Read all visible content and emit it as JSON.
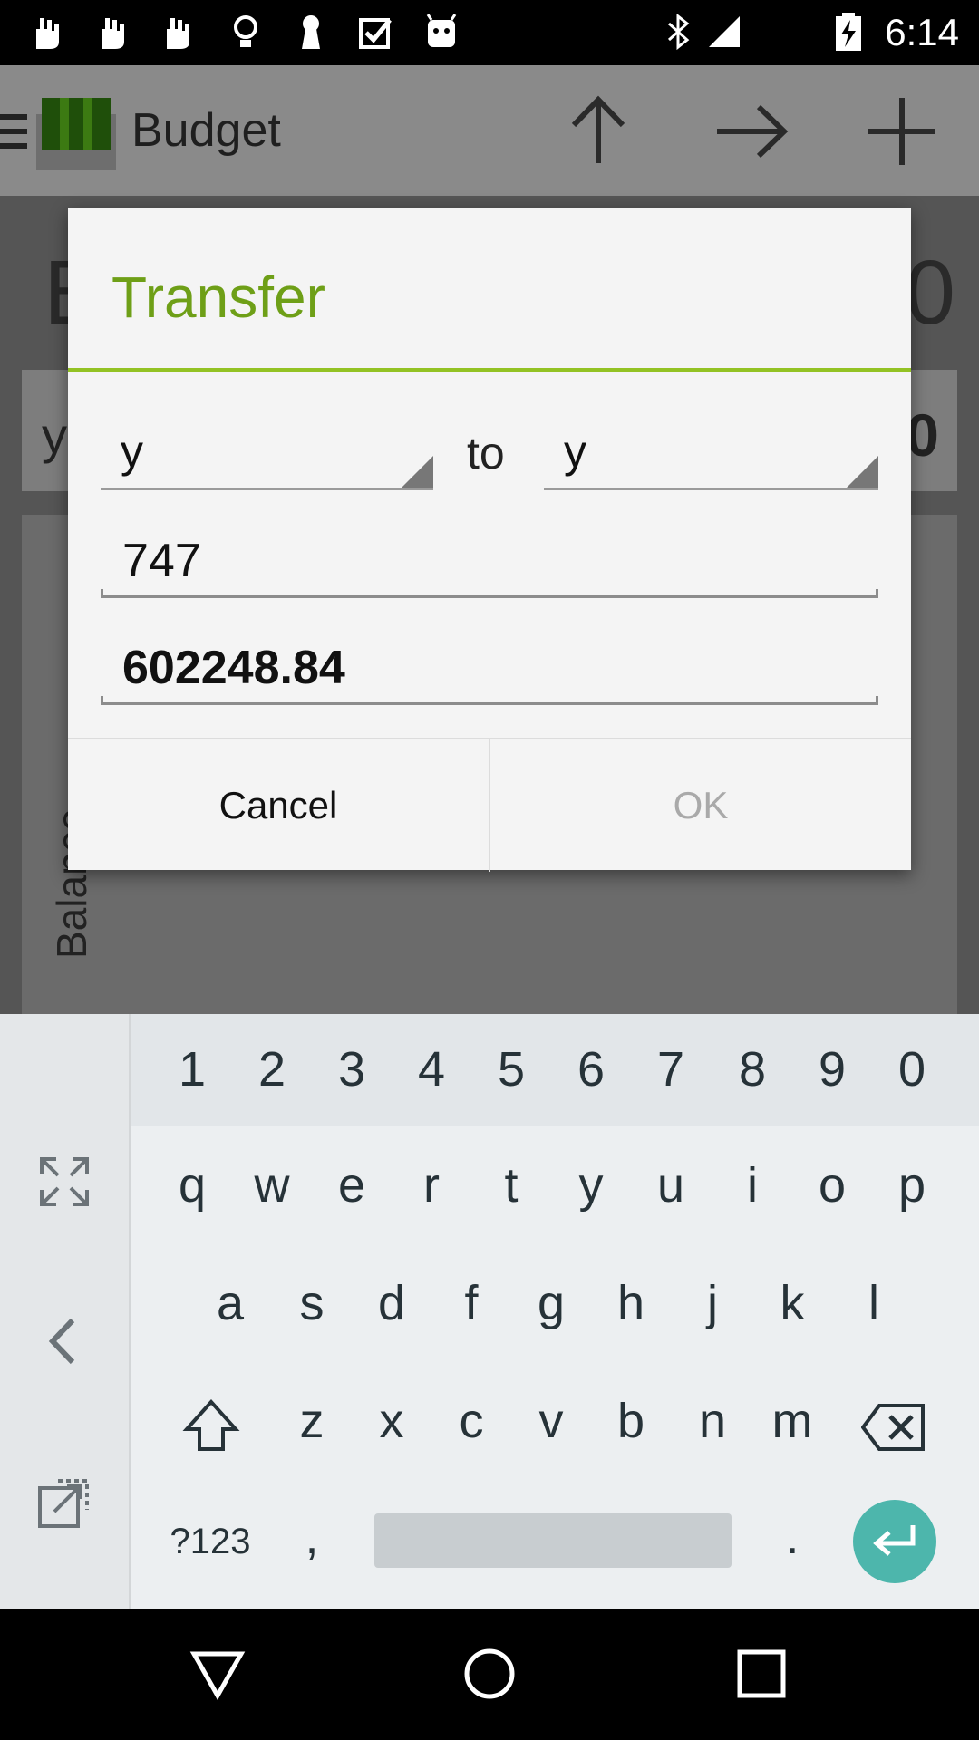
{
  "status_bar": {
    "time": "6:14",
    "left_icons": [
      "hand-icon",
      "hand-icon",
      "hand-icon",
      "lightbulb-icon",
      "keyhole-icon",
      "checkbox-icon",
      "android-icon"
    ],
    "right_icons": [
      "bluetooth-icon",
      "signal-icon",
      "battery-charging-icon"
    ]
  },
  "app_bar": {
    "title": "Budget",
    "actions": [
      "up-arrow-icon",
      "right-arrow-icon",
      "plus-icon"
    ]
  },
  "background": {
    "big_row_left": "B",
    "big_row_right": "0",
    "row2_left": "y",
    "row2_right": "0",
    "vertical_label": "Balance"
  },
  "dialog": {
    "title": "Transfer",
    "from_account": "y",
    "to_label": "to",
    "to_account": "y",
    "field1_value": "747",
    "field2_value": "602248.84",
    "cancel_label": "Cancel",
    "ok_label": "OK"
  },
  "keyboard": {
    "number_row": [
      "1",
      "2",
      "3",
      "4",
      "5",
      "6",
      "7",
      "8",
      "9",
      "0"
    ],
    "row1": [
      "q",
      "w",
      "e",
      "r",
      "t",
      "y",
      "u",
      "i",
      "o",
      "p"
    ],
    "row2": [
      "a",
      "s",
      "d",
      "f",
      "g",
      "h",
      "j",
      "k",
      "l"
    ],
    "row3": [
      "z",
      "x",
      "c",
      "v",
      "b",
      "n",
      "m"
    ],
    "symbols_key": "?123",
    "comma_key": ",",
    "period_key": ".",
    "accent_color": "#4db6ac"
  },
  "colors": {
    "dialog_title": "#6e9f17",
    "dialog_divider": "#93c224"
  }
}
